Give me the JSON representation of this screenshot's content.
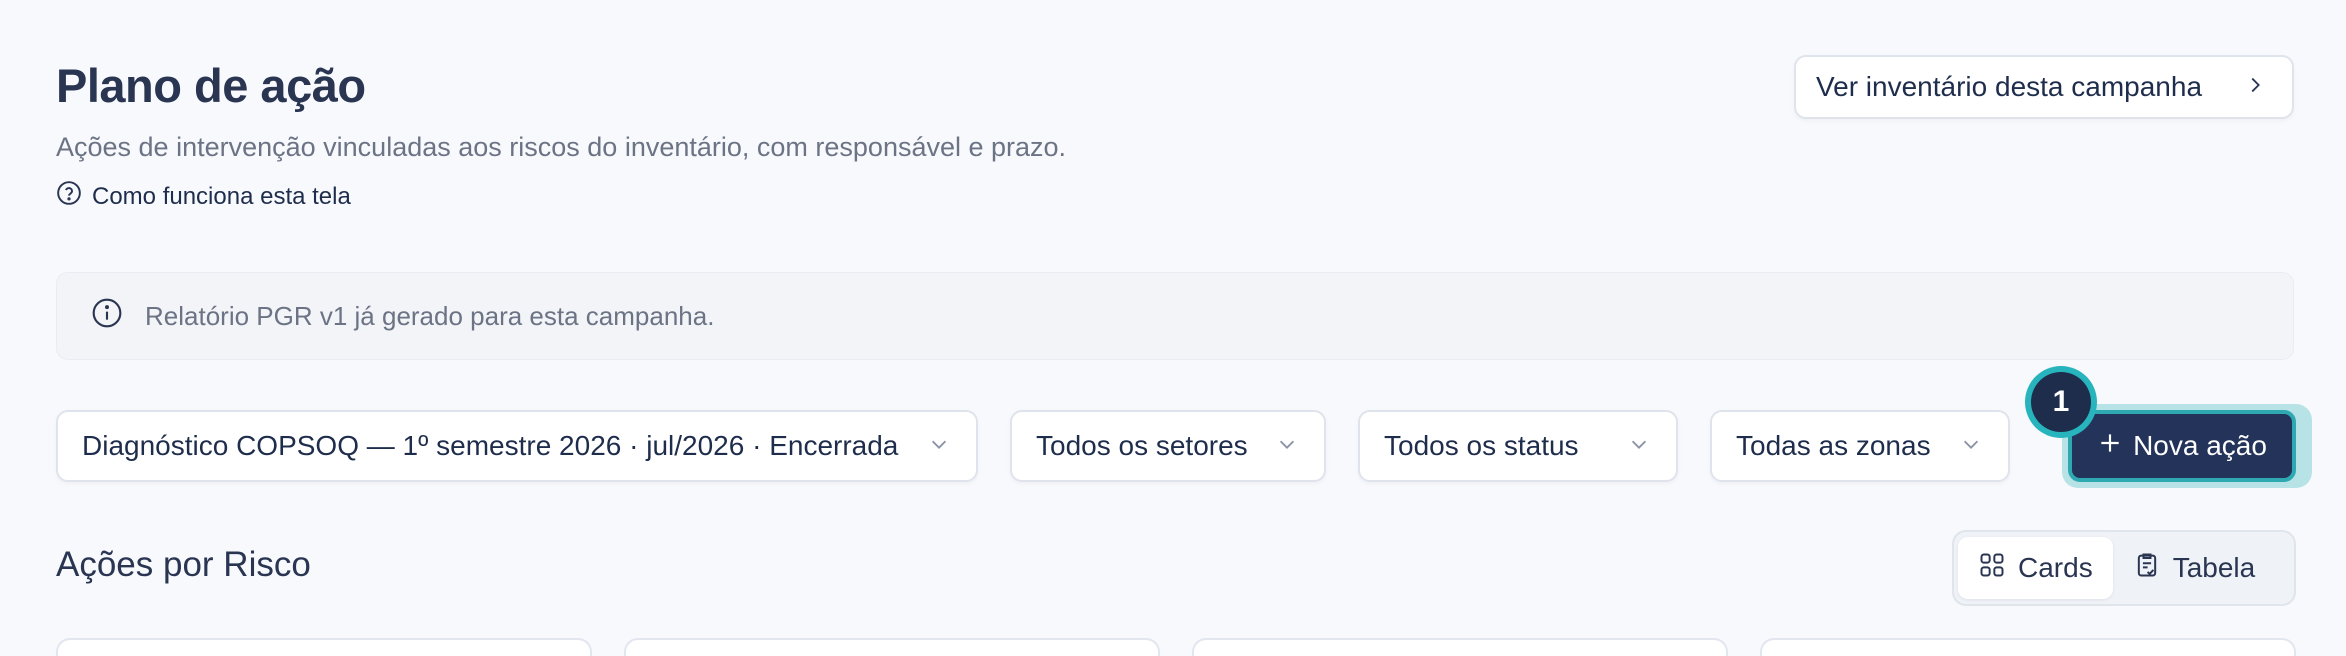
{
  "header": {
    "title": "Plano de ação",
    "subtitle": "Ações de intervenção vinculadas aos riscos do inventário, com responsável e prazo.",
    "help_link": "Como funciona esta tela",
    "inventory_button": "Ver inventário desta campanha"
  },
  "banner": {
    "text": "Relatório PGR v1 já gerado para esta campanha."
  },
  "filters": {
    "campaign": "Diagnóstico COPSOQ — 1º semestre 2026 · jul/2026 · Encerrada",
    "sector": "Todos os setores",
    "status": "Todos os status",
    "zone": "Todas as zonas"
  },
  "primary_action": {
    "label": "Nova ação",
    "step_badge": "1"
  },
  "section": {
    "title": "Ações por Risco",
    "view_cards": "Cards",
    "view_table": "Tabela",
    "active_view": "Cards"
  },
  "colors": {
    "primary": "#24335a",
    "highlight": "#27b4bd",
    "background": "#f7f9fc"
  }
}
